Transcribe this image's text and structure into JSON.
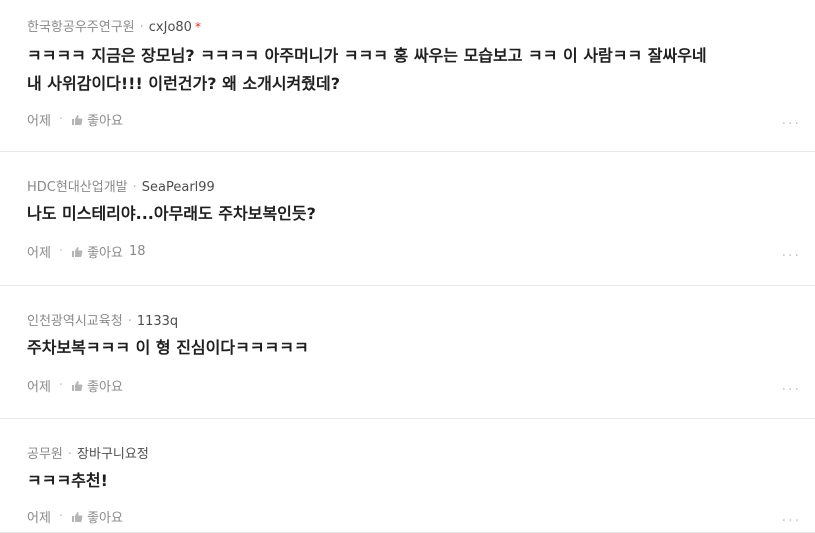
{
  "comments": [
    {
      "org": "한국항공우주연구원",
      "user": "cxJo80",
      "badge": "*",
      "text_line1": "ㅋㅋㅋㅋ 지금은 장모님?  ㅋㅋㅋㅋ  아주머니가 ㅋㅋㅋ 홍 싸우는 모습보고 ㅋㅋ 이 사람ㅋㅋ 잘싸우네",
      "text_line2": "내 사위감이다!!! 이런건가? 왜 소개시켜줬데?",
      "time": "어제",
      "like_label": "좋아요",
      "like_count": "",
      "more": "..."
    },
    {
      "org": "HDC현대산업개발",
      "user": "SeaPearl99",
      "badge": "",
      "text_line1": "나도 미스테리야...아무래도 주차보복인듯?",
      "text_line2": "",
      "time": "어제",
      "like_label": "좋아요",
      "like_count": "18",
      "more": "..."
    },
    {
      "org": "인천광역시교육청",
      "user": "1133q",
      "badge": "",
      "text_line1": "주차보복ㅋㅋㅋ 이 형 진심이다ㅋㅋㅋㅋㅋ",
      "text_line2": "",
      "time": "어제",
      "like_label": "좋아요",
      "like_count": "",
      "more": "..."
    },
    {
      "org": "공무원",
      "user": "장바구니요정",
      "badge": "",
      "text_line1": "ㅋㅋㅋ추천!",
      "text_line2": "",
      "time": "어제",
      "like_label": "좋아요",
      "like_count": "",
      "more": "..."
    }
  ],
  "icons": {
    "like": "thumbs-up-icon",
    "more": "more-dots-icon"
  },
  "colors": {
    "meta_gray": "#8a8a8a",
    "badge_red": "#e0312b",
    "divider": "#e8e8e8"
  }
}
